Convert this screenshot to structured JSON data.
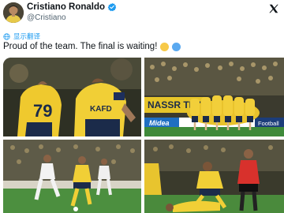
{
  "author": {
    "name": "Cristiano Ronaldo",
    "handle": "@Cristiano",
    "verified": true,
    "avatar_icon": "profile-photo"
  },
  "translate_label": "显示翻译",
  "tweet": {
    "text": "Proud of the team. The final is waiting!",
    "emojis": [
      "yellow-heart",
      "blue-heart"
    ],
    "emoji_colors": [
      "#f7c948",
      "#5aa9f0"
    ]
  },
  "colors": {
    "verified": "#1d9bf0",
    "link": "#1d9bf0",
    "handle": "#536471"
  },
  "photos": [
    {
      "alt": "players-celebrating-closeup",
      "jersey_number": "79",
      "sponsor": "KAFD"
    },
    {
      "alt": "team-huddle-on-pitch",
      "banner_1": "NASSR TICKET",
      "banner_2": "Midea",
      "banner_3": "Football"
    },
    {
      "alt": "match-action-player-dribbling"
    },
    {
      "alt": "referee-and-players-on-ground"
    }
  ]
}
